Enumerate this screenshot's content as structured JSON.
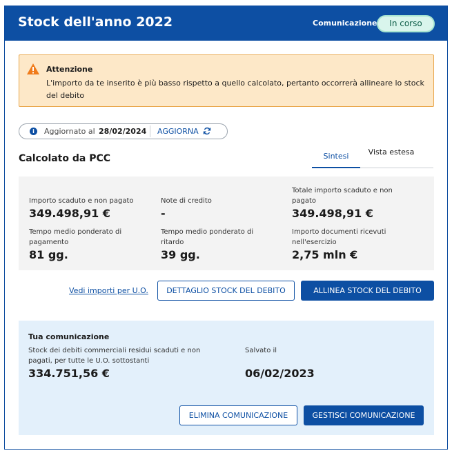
{
  "header": {
    "title": "Stock dell'anno 2022",
    "comm_label": "Comunicazione",
    "status": "In corso"
  },
  "alert": {
    "title": "Attenzione",
    "text": "L'importo da te inserito è più basso rispetto a quello calcolato, pertanto occorrerà allineare lo stock del debito"
  },
  "update": {
    "label": "Aggiornato al",
    "date": "28/02/2024",
    "button": "AGGIORNA"
  },
  "section": {
    "title": "Calcolato da PCC",
    "tabs": [
      "Sintesi",
      "Vista estesa"
    ]
  },
  "metrics": [
    {
      "label": "Importo scaduto e non pagato",
      "value": "349.498,91 €"
    },
    {
      "label": "Note di credito",
      "value": "-"
    },
    {
      "label": "Totale importo scaduto e non pagato",
      "value": "349.498,91 €"
    },
    {
      "label": "Tempo medio ponderato di pagamento",
      "value": "81 gg."
    },
    {
      "label": "Tempo medio ponderato di ritardo",
      "value": "39 gg."
    },
    {
      "label": "Importo documenti ricevuti nell'esercizio",
      "value": "2,75 mln €"
    }
  ],
  "actions": {
    "link": "Vedi importi per U.O.",
    "detail": "DETTAGLIO STOCK DEL DEBITO",
    "align": "ALLINEA STOCK DEL DEBITO"
  },
  "communication": {
    "title": "Tua comunicazione",
    "amount_label": "Stock dei debiti commerciali residui scaduti e non pagati, per tutte le U.O. sottostanti",
    "amount": "334.751,56 €",
    "saved_label": "Salvato il",
    "saved_date": "06/02/2023",
    "delete": "ELIMINA COMUNICAZIONE",
    "manage": "GESTISCI COMUNICAZIONE"
  },
  "colors": {
    "primary": "#0d4fa3",
    "alert_bg": "#fde8c8",
    "alert_border": "#e9a64b",
    "warning_icon": "#f07c1b",
    "status_bg": "#d9f5ec",
    "comm_bg": "#e3f0fb"
  }
}
